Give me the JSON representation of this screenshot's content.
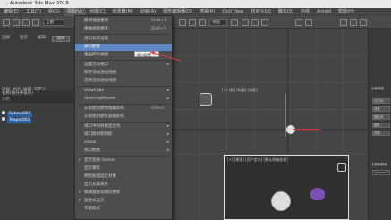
{
  "window": {
    "title": "- Autodesk 3ds Max 2018"
  },
  "menubar": {
    "items": [
      "编辑(E)",
      "工具(T)",
      "组(G)",
      "视图(V)",
      "创建(C)",
      "修改器(M)",
      "动画(A)",
      "图形编辑器(D)",
      "渲染(R)",
      "Civil View",
      "自定义(U)",
      "脚本(S)",
      "内容",
      "Arnold",
      "帮助(H)"
    ]
  },
  "toolbar": {
    "dropdown": "全部",
    "view_label": "视图"
  },
  "left_panel": {
    "tabs": [
      "选择",
      "显示",
      "编辑",
      "自定义"
    ],
    "select_button": "选择"
  },
  "scene_explorer": {
    "header": "名称(按升序排序)",
    "sub_header": "冻结",
    "objects": [
      {
        "label": "Sphere001"
      },
      {
        "label": "Teapot001"
      }
    ]
  },
  "menu": {
    "items": [
      {
        "label": "撤消视图更改",
        "shortcut": "Shift+Z",
        "highlight": false
      },
      {
        "label": "重做视图更改",
        "shortcut": "Shift+Y",
        "highlight": false
      },
      {
        "label": "视口背景设置",
        "shortcut": "",
        "highlight": false
      },
      {
        "label": "视口配置",
        "shortcut": "",
        "highlight": true
      },
      {
        "label": "重画所有视图",
        "shortcut": "",
        "highlight": false
      },
      {
        "label": "设置活动视口",
        "shortcut": "",
        "highlight": false,
        "submenu": true
      },
      {
        "label": "保存活动透视视图",
        "shortcut": "",
        "highlight": false
      },
      {
        "label": "还原活动透视视图",
        "shortcut": "",
        "highlight": false
      },
      {
        "label": "ViewCube",
        "shortcut": "",
        "highlight": false,
        "submenu": true
      },
      {
        "label": "SteeringWheels",
        "shortcut": "",
        "highlight": false,
        "submenu": true
      },
      {
        "label": "从视图创建物理摄影机",
        "shortcut": "Ctrl+C",
        "highlight": false
      },
      {
        "label": "从视图创建标准摄影机",
        "shortcut": "",
        "highlight": false
      },
      {
        "label": "视口中的材质显示为",
        "shortcut": "",
        "highlight": false,
        "submenu": true
      },
      {
        "label": "视口照明和阴影",
        "shortcut": "",
        "highlight": false,
        "submenu": true
      },
      {
        "label": "xView",
        "shortcut": "",
        "highlight": false,
        "submenu": true
      },
      {
        "label": "视口图像",
        "shortcut": "",
        "highlight": false,
        "submenu": true
      },
      {
        "label": "显示变换 Gizmo",
        "shortcut": "",
        "highlight": false,
        "checked": true
      },
      {
        "label": "显示重影",
        "shortcut": "",
        "highlight": false
      },
      {
        "label": "明暗处理选定对象",
        "shortcut": "",
        "highlight": false
      },
      {
        "label": "显示从属关系",
        "shortcut": "",
        "highlight": false
      },
      {
        "label": "微调器拖动期间更新",
        "shortcut": "",
        "highlight": false,
        "checked": true
      },
      {
        "label": "渐进式显示",
        "shortcut": "",
        "highlight": false,
        "checked": true
      },
      {
        "label": "专家模式",
        "shortcut": "",
        "highlight": false
      }
    ]
  },
  "tooltip": {
    "text": "视口配置"
  },
  "viewport": {
    "top_label": "[+] [前] [标准] [线框]",
    "persp_label": "[+] [透视] [用户定义] [默认明暗处理]"
  },
  "right_panel": {
    "label": "对象类型",
    "buttons": [
      "长方体",
      "球体",
      "圆柱体",
      "圆环",
      "茶壶"
    ],
    "bottom": "名称和颜色",
    "name_field": "Sphere001"
  }
}
